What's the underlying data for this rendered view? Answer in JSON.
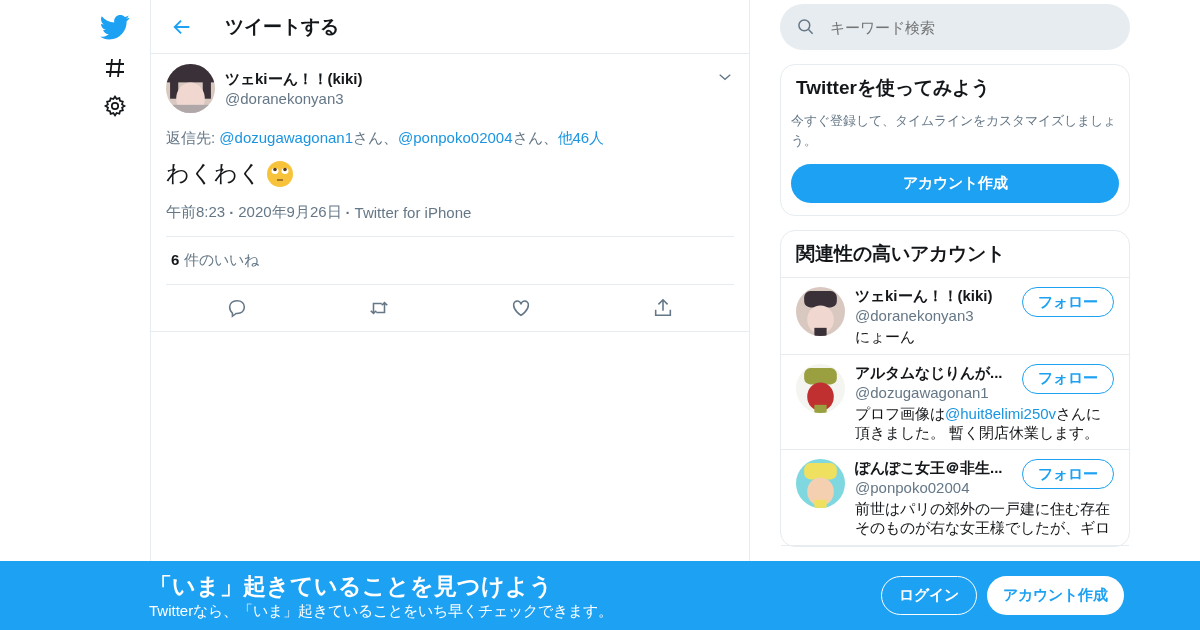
{
  "header": {
    "title": "ツイートする"
  },
  "tweet": {
    "name": "ツェkiーん！！(kiki)",
    "handle": "@doranekonyan3",
    "reply_to": [
      {
        "kind": "text",
        "text": "返信先: "
      },
      {
        "kind": "link",
        "text": "@dozugawagonan1"
      },
      {
        "kind": "text",
        "text": "さん、"
      },
      {
        "kind": "link",
        "text": "@ponpoko02004"
      },
      {
        "kind": "text",
        "text": "さん、"
      },
      {
        "kind": "link",
        "text": "他46人"
      }
    ],
    "text": "わくわく",
    "separator": "·",
    "time": "午前8:23",
    "date": "2020年9月26日",
    "source": "Twitter for iPhone",
    "likes": "**6** 件のいいね"
  },
  "search": {
    "placeholder": "キーワード検索"
  },
  "signup": {
    "title": "Twitterを使ってみよう",
    "text": "今すぐ登録して、タイムラインをカスタマイズしましょう。",
    "button": "アカウント作成"
  },
  "related": {
    "title": "関連性の高いアカウント",
    "accounts": [
      {
        "name": "ツェkiーん！！(kiki)",
        "handle": "@doranekonyan3",
        "button": "フォロー",
        "bio": [
          {
            "kind": "text",
            "text": "にょーん"
          }
        ]
      },
      {
        "name": "アルタムなじりんが...",
        "handle": "@dozugawagonan1",
        "button": "フォロー",
        "bio": [
          {
            "kind": "text",
            "text": "プロフ画像は"
          },
          {
            "kind": "link",
            "text": "@huit8elimi250v"
          },
          {
            "kind": "text",
            "text": "さんに頂きました。 暫く閉店休業します。"
          }
        ]
      },
      {
        "name": "ぽんぽこ女王＠非生...",
        "handle": "@ponpoko02004",
        "button": "フォロー",
        "bio": [
          {
            "kind": "text",
            "text": "前世はパリの郊外の一戸建に住む存在そのものが右な女王様でしたが、ギロ"
          }
        ]
      }
    ]
  },
  "banner": {
    "title": "「いま」起きていることを見つけよう",
    "text": "Twitterなら、「いま」起きていることをいち早くチェックできます。",
    "login": "ログイン",
    "signup": "アカウント作成"
  }
}
